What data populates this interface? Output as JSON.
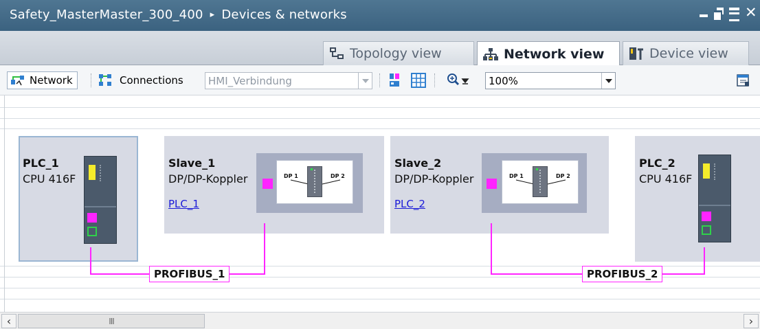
{
  "title_bar": {
    "project": "Safety_MasterMaster_300_400",
    "separator": "▸",
    "section": "Devices & networks"
  },
  "view_tabs": [
    {
      "label": "Topology view",
      "active": false,
      "icon": "topology-icon"
    },
    {
      "label": "Network view",
      "active": true,
      "icon": "network-icon"
    },
    {
      "label": "Device view",
      "active": false,
      "icon": "device-icon"
    }
  ],
  "toolbar": {
    "network_label": "Network",
    "connections_label": "Connections",
    "connection_type": "HMI_Verbindung",
    "zoom_value": "100%"
  },
  "devices": [
    {
      "name": "PLC_1",
      "type": "CPU 416F",
      "kind": "cpu"
    },
    {
      "name": "Slave_1",
      "type": "DP/DP-Koppler",
      "link": "PLC_1",
      "kind": "coupler"
    },
    {
      "name": "Slave_2",
      "type": "DP/DP-Koppler",
      "link": "PLC_2",
      "kind": "coupler"
    },
    {
      "name": "PLC_2",
      "type": "CPU 416F",
      "kind": "cpu"
    }
  ],
  "coupler_ports": {
    "left": "DP 1",
    "right": "DP 2"
  },
  "networks": [
    {
      "label": "PROFIBUS_1"
    },
    {
      "label": "PROFIBUS_2"
    }
  ],
  "colors": {
    "profibus": "#ff24ff",
    "profinet_port": "#2fd24a",
    "title_bar": "#4a7090",
    "device_bg": "#d7dae4"
  },
  "scrollbar": {
    "thumb_grip": "III"
  }
}
